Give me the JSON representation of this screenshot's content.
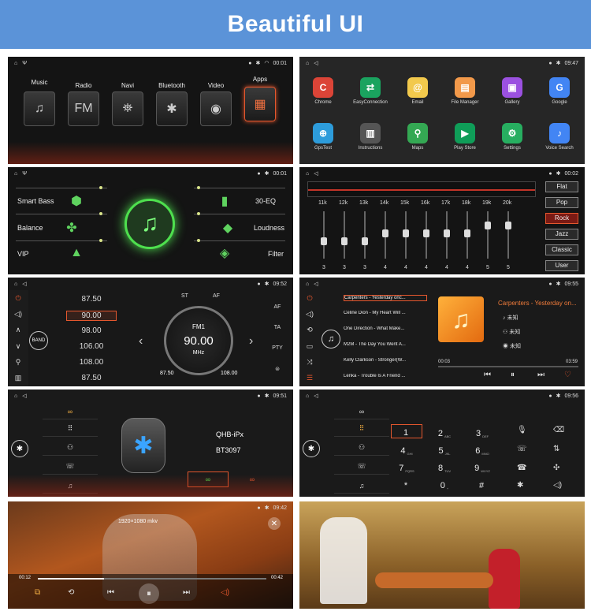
{
  "header": {
    "title": "Beautiful UI"
  },
  "status": {
    "time1": "00:01",
    "time2": "09:47",
    "time3": "00:01",
    "time4": "00:02",
    "time5": "09:52",
    "time6": "09:55",
    "time7": "09:51",
    "time8": "09:56",
    "time9": "09:42"
  },
  "home": {
    "items": [
      {
        "label": "Music",
        "glyph": "♫"
      },
      {
        "label": "Radio",
        "glyph": "FM"
      },
      {
        "label": "Navi",
        "glyph": "⛯"
      },
      {
        "label": "Bluetooth",
        "glyph": "✱"
      },
      {
        "label": "Video",
        "glyph": "◉"
      },
      {
        "label": "Apps",
        "glyph": "▦"
      }
    ]
  },
  "apps": {
    "items": [
      {
        "label": "Chrome",
        "color": "#db4437",
        "glyph": "C"
      },
      {
        "label": "EasyConnection",
        "color": "#1aa35f",
        "glyph": "⇄"
      },
      {
        "label": "Email",
        "color": "#f2c94c",
        "glyph": "@"
      },
      {
        "label": "File Manager",
        "color": "#f2994a",
        "glyph": "▤"
      },
      {
        "label": "Gallery",
        "color": "#9b51e0",
        "glyph": "▣"
      },
      {
        "label": "Google",
        "color": "#4285f4",
        "glyph": "G"
      },
      {
        "label": "GpsTest",
        "color": "#2d9cdb",
        "glyph": "⊕"
      },
      {
        "label": "Instructions",
        "color": "#555555",
        "glyph": "▥"
      },
      {
        "label": "Maps",
        "color": "#34a853",
        "glyph": "⚲"
      },
      {
        "label": "Play Store",
        "color": "#0f9d58",
        "glyph": "▶"
      },
      {
        "label": "Settings",
        "color": "#27ae60",
        "glyph": "⚙"
      },
      {
        "label": "Voice Search",
        "color": "#4285f4",
        "glyph": "♪"
      }
    ]
  },
  "sound": {
    "smart_bass": "Smart Bass",
    "balance": "Balance",
    "vip": "VIP",
    "eq": "30-EQ",
    "loudness": "Loudness",
    "filter": "Filter"
  },
  "equalizer": {
    "freqs": [
      "11k",
      "12k",
      "13k",
      "14k",
      "15k",
      "16k",
      "17k",
      "18k",
      "19k",
      "20k"
    ],
    "values": [
      "3",
      "3",
      "3",
      "4",
      "4",
      "4",
      "4",
      "4",
      "5",
      "5"
    ],
    "levels": [
      0.35,
      0.35,
      0.35,
      0.55,
      0.55,
      0.55,
      0.55,
      0.55,
      0.75,
      0.75
    ],
    "presets": [
      {
        "label": "Flat"
      },
      {
        "label": "Pop"
      },
      {
        "label": "Rock"
      },
      {
        "label": "Jazz"
      },
      {
        "label": "Classic"
      },
      {
        "label": "User"
      }
    ]
  },
  "radio": {
    "freqs": [
      "87.50",
      "90.00",
      "98.00",
      "106.00",
      "108.00",
      "87.50"
    ],
    "band": "BAND",
    "st": "ST",
    "af_top": "AF",
    "fm": "FM1",
    "value": "90.00",
    "unit": "MHz",
    "min": "87.50",
    "max": "108.00",
    "tabs": [
      "AF",
      "TA",
      "PTY",
      "⊜"
    ]
  },
  "music": {
    "songs": [
      "Carpenters - Yesterday onc...",
      "Celine Dion - My Heart Will ...",
      "One Direction - What Make...",
      "M2M - The Day You Went A...",
      "Kelly Clarkson - Stronger(W...",
      "Lenka - Trouble Is A Friend ..."
    ],
    "now_title": "Carpenters - Yesterday on...",
    "artist": "未知",
    "album": "未知",
    "other": "未知",
    "elapsed": "00:03",
    "total": "03:59"
  },
  "bluetooth": {
    "name": "QHB-iPx",
    "pin": "BT3097"
  },
  "dialer": {
    "keys": [
      {
        "n": "1",
        "s": ""
      },
      {
        "n": "2",
        "s": "ABC"
      },
      {
        "n": "3",
        "s": "DEF"
      },
      {
        "n": "4",
        "s": "GHI"
      },
      {
        "n": "5",
        "s": "JKL"
      },
      {
        "n": "6",
        "s": "MNO"
      },
      {
        "n": "7",
        "s": "PQRS"
      },
      {
        "n": "8",
        "s": "TUV"
      },
      {
        "n": "9",
        "s": "WXYZ"
      },
      {
        "n": "*",
        "s": ""
      },
      {
        "n": "0",
        "s": "+"
      },
      {
        "n": "#",
        "s": ""
      }
    ]
  },
  "video": {
    "res": "1920×1080 mkv",
    "elapsed": "00:12",
    "total": "00:42",
    "progress": 0.29
  }
}
